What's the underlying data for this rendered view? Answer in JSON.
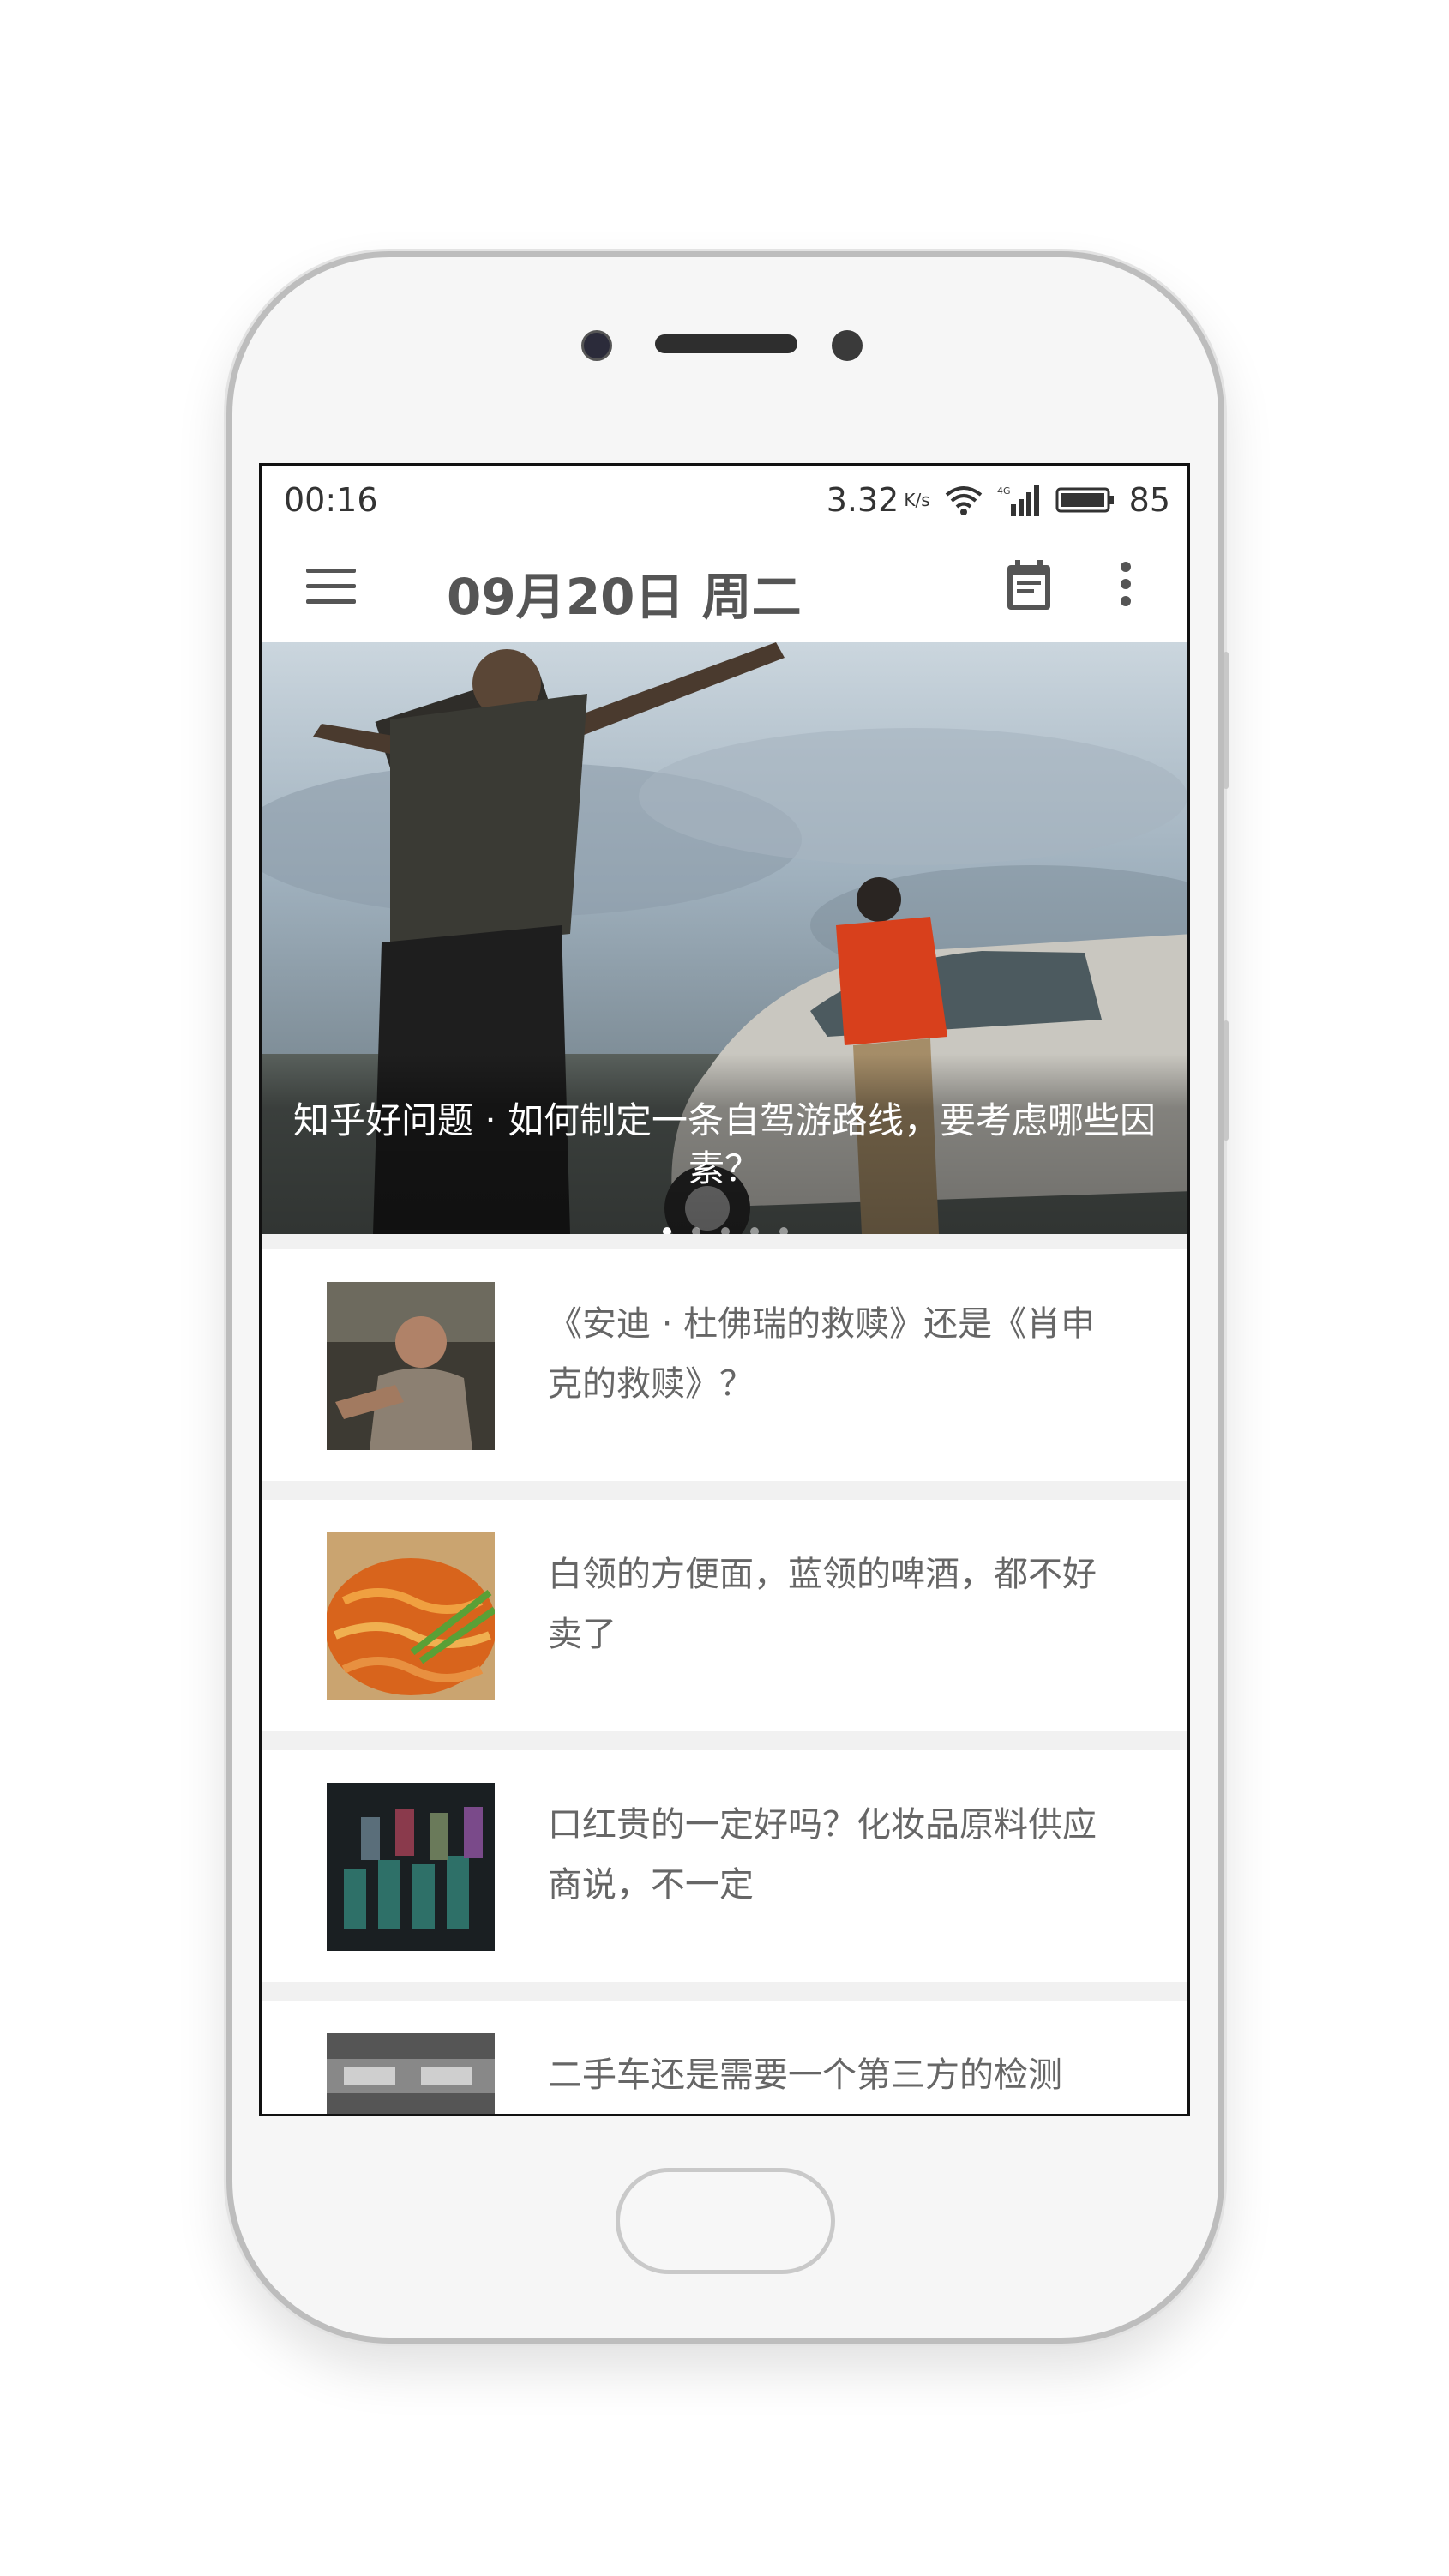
{
  "status_bar": {
    "time": "00:16",
    "speed": "3.32",
    "speed_unit": "K/s",
    "battery": "85"
  },
  "app_bar": {
    "title": "09月20日 周二",
    "menu_icon": "hamburger-menu-icon",
    "calendar_icon": "calendar-icon",
    "more_icon": "more-vertical-icon"
  },
  "hero": {
    "caption": "知乎好问题 · 如何制定一条自驾游路线，要考虑哪些因素？",
    "page_count": 5,
    "active_page": 1
  },
  "articles": [
    {
      "title": "《安迪 · 杜佛瑞的救赎》还是《肖申克的救赎》？"
    },
    {
      "title": "白领的方便面，蓝领的啤酒，都不好卖了"
    },
    {
      "title": "口红贵的一定好吗？化妆品原料供应商说，不一定"
    },
    {
      "title": "二手车还是需要一个第三方的检测"
    }
  ]
}
